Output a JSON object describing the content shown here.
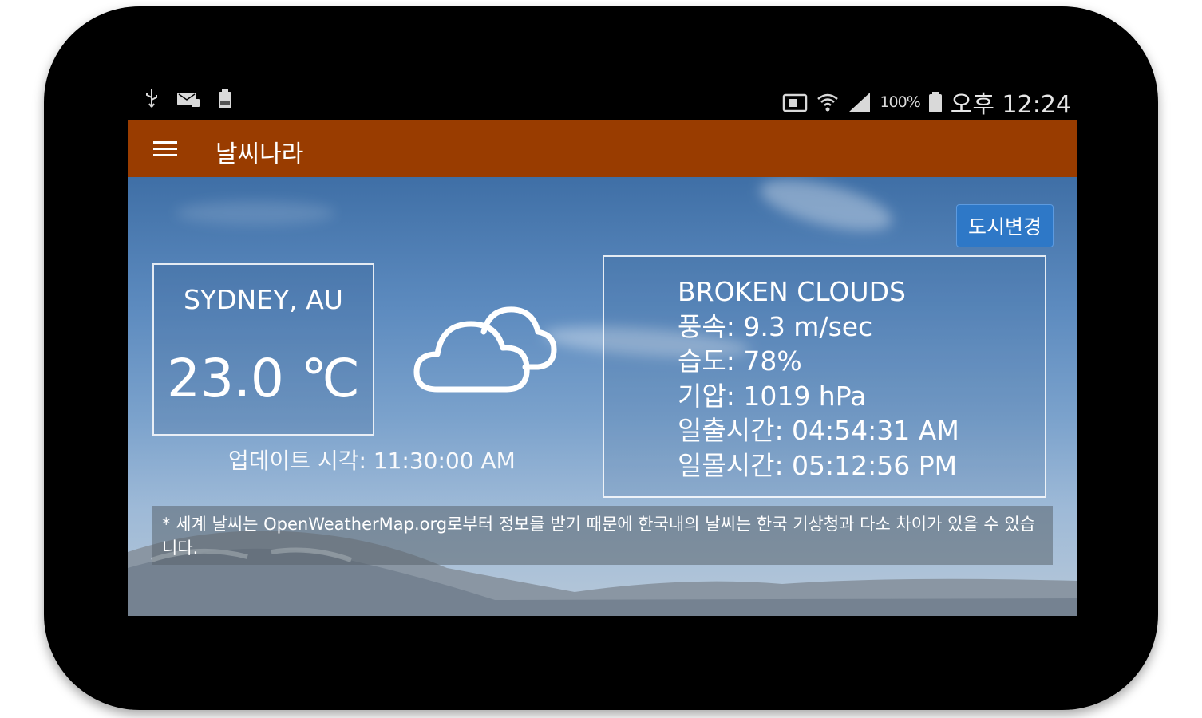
{
  "status_bar": {
    "left_icons": [
      "usb-icon",
      "message-icon",
      "battery-saver-icon"
    ],
    "battery_percent": "100%",
    "time": "오후 12:24"
  },
  "app_bar": {
    "title": "날씨나라"
  },
  "actions": {
    "change_city_label": "도시변경"
  },
  "weather": {
    "city": "SYDNEY, AU",
    "temperature": "23.0 ℃",
    "update_time": "업데이트 시각: 11:30:00 AM",
    "icon": "broken-clouds-icon",
    "details": {
      "condition": "BROKEN CLOUDS",
      "wind": "풍속: 9.3 m/sec",
      "humidity": "습도: 78%",
      "pressure": "기압: 1019 hPa",
      "sunrise": "일출시간: 04:54:31 AM",
      "sunset": "일몰시간: 05:12:56 PM"
    }
  },
  "notice": "* 세계 날씨는 OpenWeatherMap.org로부터 정보를 받기 때문에 한국내의 날씨는 한국 기상청과 다소 차이가 있을 수 있습니다.",
  "colors": {
    "app_bar": "#993c00",
    "button": "#2e78c7",
    "tablet_frame": "#000000"
  }
}
